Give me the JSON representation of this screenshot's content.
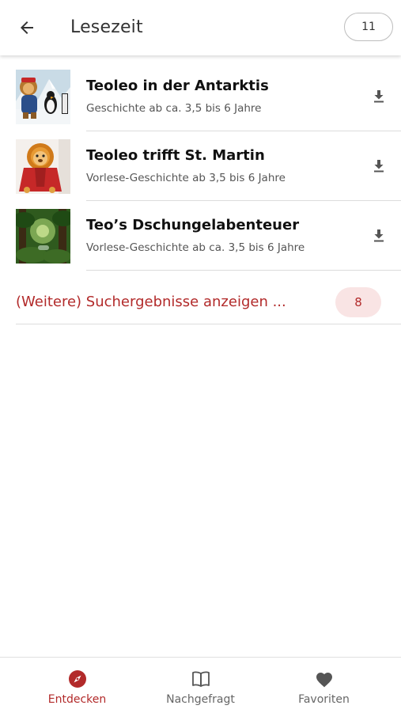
{
  "colors": {
    "accent": "#b22a2a",
    "accent_light": "#f9e4e4",
    "icon_gray": "#555555",
    "divider": "#dcdcdc"
  },
  "app_bar": {
    "back_icon": "arrow-left-icon",
    "title": "Lesezeit",
    "count": "11"
  },
  "results": [
    {
      "title": "Teoleo in der Antarktis",
      "subtitle": "Geschichte ab ca. 3,5 bis 6 Jahre",
      "thumbnail": "plush-lion-with-penguin-in-snow",
      "action_icon": "download-icon"
    },
    {
      "title": "Teoleo trifft St. Martin",
      "subtitle": "Vorlese-Geschichte ab 3,5 bis 6 Jahre",
      "thumbnail": "plush-lion-with-red-cape",
      "action_icon": "download-icon"
    },
    {
      "title": "Teo’s Dschungelabenteuer",
      "subtitle": "Vorlese-Geschichte ab ca. 3,5 bis 6 Jahre",
      "thumbnail": "jungle-scene",
      "action_icon": "download-icon"
    }
  ],
  "more_results": {
    "label": "(Weitere) Suchergebnisse anzeigen ...",
    "count": "8"
  },
  "bottom_nav": [
    {
      "label": "Entdecken",
      "icon": "compass-icon",
      "active": true
    },
    {
      "label": "Nachgefragt",
      "icon": "book-icon",
      "active": false
    },
    {
      "label": "Favoriten",
      "icon": "heart-icon",
      "active": false
    }
  ]
}
